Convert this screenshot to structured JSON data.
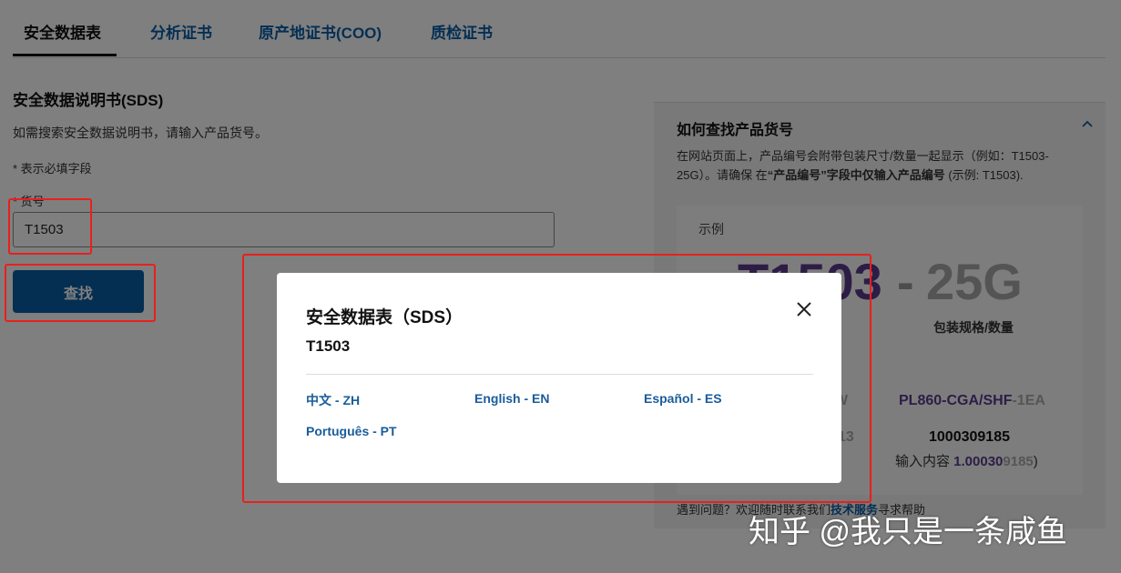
{
  "tabs": [
    {
      "label": "安全数据表"
    },
    {
      "label": "分析证书"
    },
    {
      "label": "原产地证书(COO)"
    },
    {
      "label": "质检证书"
    }
  ],
  "form": {
    "title": "安全数据说明书(SDS)",
    "description": "如需搜索安全数据说明书，请输入产品货号。",
    "required_note": "* 表示必填字段",
    "field_label": "* 货号",
    "field_value": "T1503",
    "button_label": "查找"
  },
  "help": {
    "title": "如何查找产品货号",
    "text_1": "在网站页面上，产品编号会附带包装尺寸/数量一起显示（例如：T1503-25G）。请确保 在",
    "text_bold": "“产品编号”字段中仅输入产品编号",
    "text_2": " (示例: T1503).",
    "example_label": "示例",
    "example_product": "T1503",
    "example_dash": "-",
    "example_size": "25G",
    "pack_label": "包装规格/数量",
    "w_fragment": "W",
    "pl_main": "PL860-CGA/SHF",
    "pl_suffix": "-1EA",
    "num_fragment": "13",
    "number": "1000309185",
    "input_prefix": "输入内容 ",
    "input_purple": "1.00030",
    "input_gray": "9185",
    "input_suffix": ")",
    "footer_prefix": "遇到问题？欢迎随时联系我们",
    "footer_link": "技术服务",
    "footer_suffix": "寻求帮助"
  },
  "modal": {
    "title": "安全数据表（SDS）",
    "product": "T1503",
    "languages": [
      {
        "label": "中文 - ZH"
      },
      {
        "label": "English - EN"
      },
      {
        "label": "Español - ES"
      },
      {
        "label": "Português - PT"
      }
    ]
  },
  "watermark": "知乎 @我只是一条咸鱼",
  "colors": {
    "accent": "#0b5fa5",
    "highlight_box": "#e8201c",
    "example_purple": "#5a3a8c"
  }
}
